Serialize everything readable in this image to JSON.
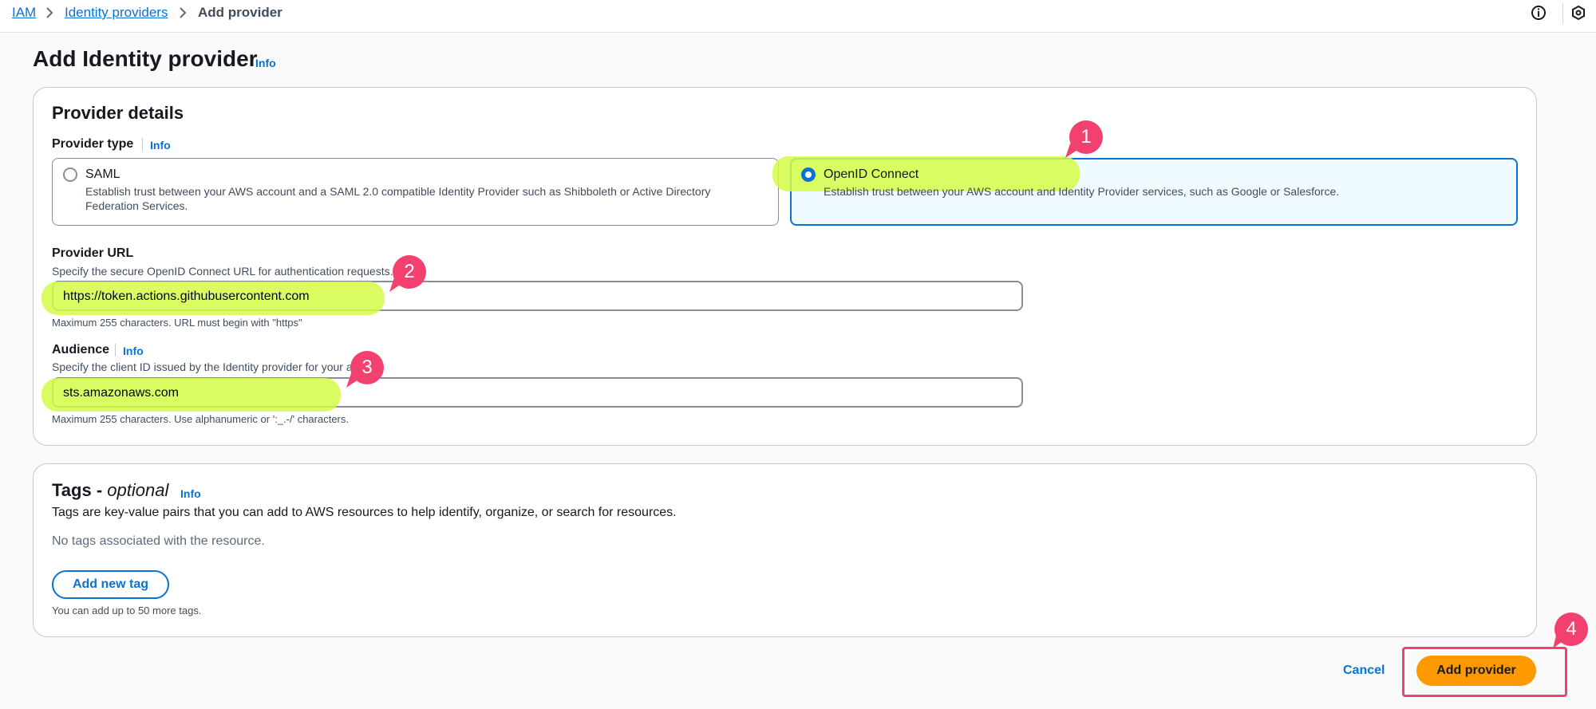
{
  "breadcrumb": {
    "items": [
      {
        "label": "IAM"
      },
      {
        "label": "Identity providers"
      },
      {
        "label": "Add provider"
      }
    ]
  },
  "header": {
    "title": "Add Identity provider",
    "info_label": "Info"
  },
  "provider_details": {
    "heading": "Provider details",
    "provider_type": {
      "label": "Provider type",
      "info_label": "Info",
      "options": [
        {
          "title": "SAML",
          "description": "Establish trust between your AWS account and a SAML 2.0 compatible Identity Provider such as Shibboleth or Active Directory Federation Services.",
          "selected": false
        },
        {
          "title": "OpenID Connect",
          "description": "Establish trust between your AWS account and Identity Provider services, such as Google or Salesforce.",
          "selected": true
        }
      ]
    },
    "provider_url": {
      "label": "Provider URL",
      "description": "Specify the secure OpenID Connect URL for authentication requests.",
      "value": "https://token.actions.githubusercontent.com",
      "constraint": "Maximum 255 characters. URL must begin with \"https\""
    },
    "audience": {
      "label": "Audience",
      "info_label": "Info",
      "description": "Specify the client ID issued by the Identity provider for your app.",
      "value": "sts.amazonaws.com",
      "constraint": "Maximum 255 characters. Use alphanumeric or ':_.-/' characters."
    }
  },
  "tags": {
    "heading": "Tags - ",
    "heading_optional": "optional",
    "info_label": "Info",
    "description": "Tags are key-value pairs that you can add to AWS resources to help identify, organize, or search for resources.",
    "empty_text": "No tags associated with the resource.",
    "add_button_label": "Add new tag",
    "limit_text": "You can add up to 50 more tags."
  },
  "footer": {
    "cancel_label": "Cancel",
    "submit_label": "Add provider"
  },
  "annotations": {
    "callouts": [
      "1",
      "2",
      "3",
      "4"
    ],
    "highlight_color": "#d4fb46",
    "callout_color": "#f2416e"
  },
  "colors": {
    "link": "#0972d3",
    "primary_button": "#ff9900",
    "selected_tile_bg": "#f0fbff",
    "selected_tile_border": "#0972d3"
  },
  "icons": {
    "info": "info-circle-icon",
    "settings": "hexagon-settings-icon",
    "chevron": "chevron-right-icon"
  }
}
